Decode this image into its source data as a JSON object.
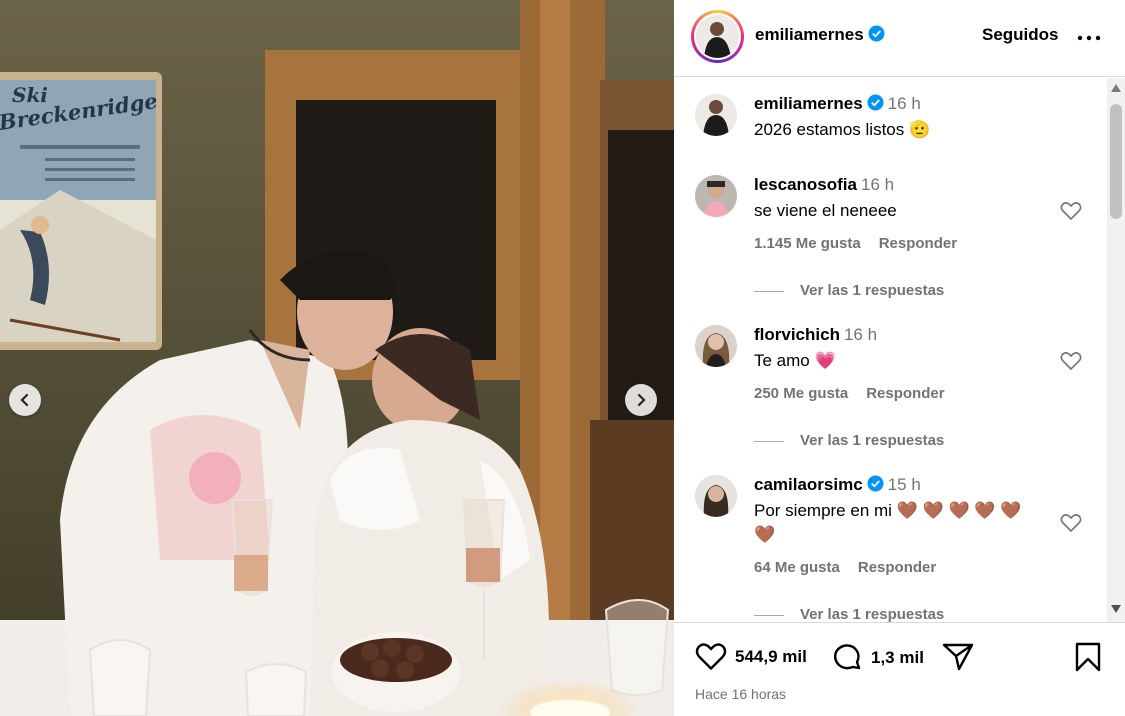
{
  "post": {
    "author": "emiliamernes",
    "follow_label": "Seguidos",
    "caption_author": "emiliamernes",
    "caption_time": "16 h",
    "caption_text": "2026 estamos listos",
    "caption_emoji": "🫡"
  },
  "photo": {
    "poster_title_1": "Ski",
    "poster_title_2": "Breckenridge",
    "icons": {
      "prev": "chevron-left-icon",
      "next": "chevron-right-icon"
    }
  },
  "comments": [
    {
      "user": "lescanosofia",
      "time": "16 h",
      "text": "se viene el neneee",
      "emoji": "",
      "likes": "1.145 Me gusta",
      "reply": "Responder",
      "replies": "Ver las 1 respuestas"
    },
    {
      "user": "florvichich",
      "time": "16 h",
      "text": "Te amo",
      "emoji": "💗",
      "likes": "250 Me gusta",
      "reply": "Responder",
      "replies": "Ver las 1 respuestas"
    },
    {
      "user": "camilaorsimc",
      "time": "15 h",
      "text": "Por siempre en mi",
      "emoji": "🤎 🤎 🤎 🤎 🤎",
      "text_line2": "🤎",
      "likes": "64 Me gusta",
      "reply": "Responder",
      "replies": "Ver las 1 respuestas"
    }
  ],
  "footer": {
    "likes": "544,9 mil",
    "comments": "1,3 mil",
    "time_ago": "Hace 16 horas"
  },
  "colors": {
    "verified": "#0095f6",
    "muted": "#737373",
    "border": "#dbdbdb"
  }
}
